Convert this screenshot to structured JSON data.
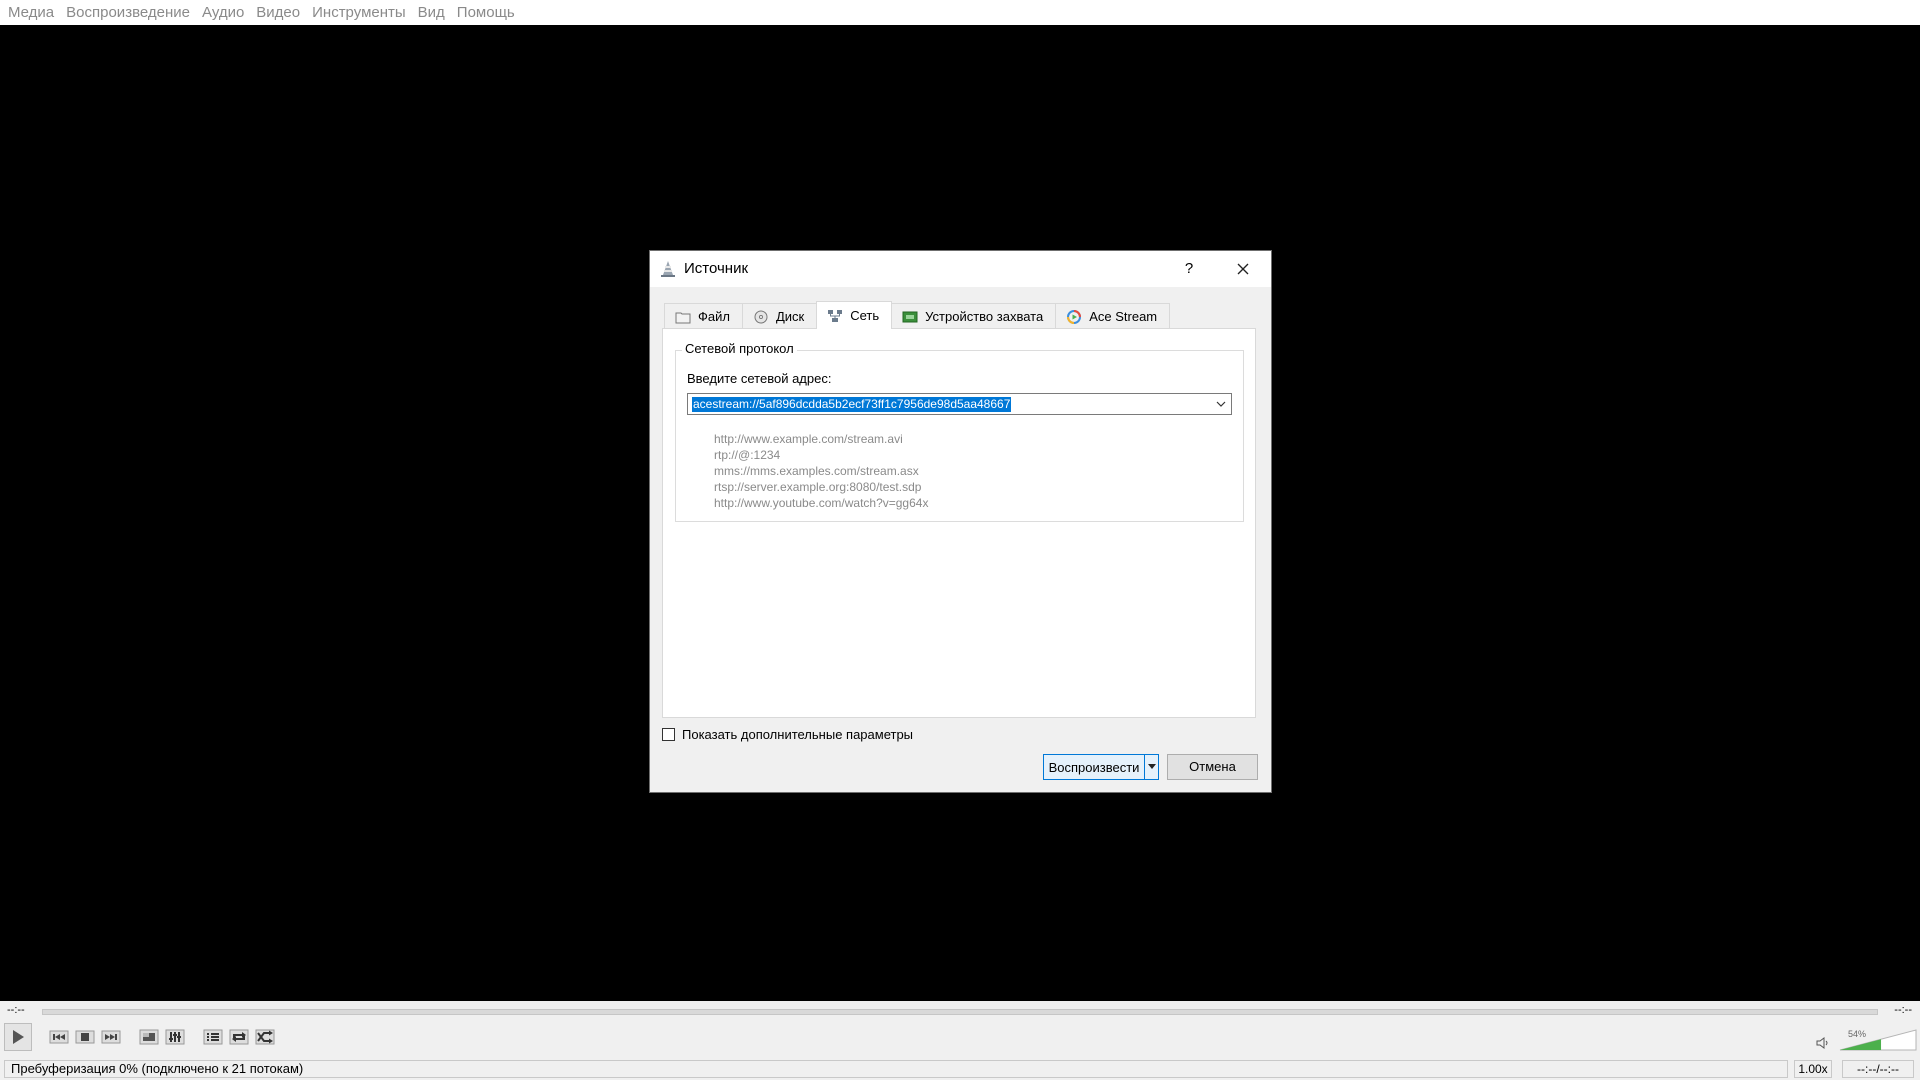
{
  "menubar": {
    "items": [
      "Медиа",
      "Воспроизведение",
      "Аудио",
      "Видео",
      "Инструменты",
      "Вид",
      "Помощь"
    ]
  },
  "dialog": {
    "title": "Источник",
    "help_label": "?",
    "tabs": [
      {
        "label": "Файл",
        "icon": "folder-icon"
      },
      {
        "label": "Диск",
        "icon": "disc-icon"
      },
      {
        "label": "Сеть",
        "icon": "network-icon"
      },
      {
        "label": "Устройство захвата",
        "icon": "capture-device-icon"
      },
      {
        "label": "Ace Stream",
        "icon": "acestream-icon"
      }
    ],
    "active_tab": "Сеть",
    "group_title": "Сетевой протокол",
    "address_label": "Введите сетевой адрес:",
    "address_value": "acestream://5af896dcdda5b2ecf73ff1c7956de98d5aa48667",
    "examples": [
      "http://www.example.com/stream.avi",
      "rtp://@:1234",
      "mms://mms.examples.com/stream.asx",
      "rtsp://server.example.org:8080/test.sdp",
      "http://www.youtube.com/watch?v=gg64x"
    ],
    "show_more_label": "Показать дополнительные параметры",
    "show_more_checked": false,
    "play_label": "Воспроизвести",
    "cancel_label": "Отмена"
  },
  "player": {
    "time_elapsed": "--:--",
    "time_remaining": "--:--",
    "volume_percent": "54%",
    "volume_level": 0.54,
    "status_text": "Пребуферизация 0% (подключено к 21 потокам)",
    "playback_rate": "1.00x",
    "time_total": "--:--/--:--"
  },
  "colors": {
    "accent": "#0078d7",
    "volume_fill": "#4cb04c"
  }
}
